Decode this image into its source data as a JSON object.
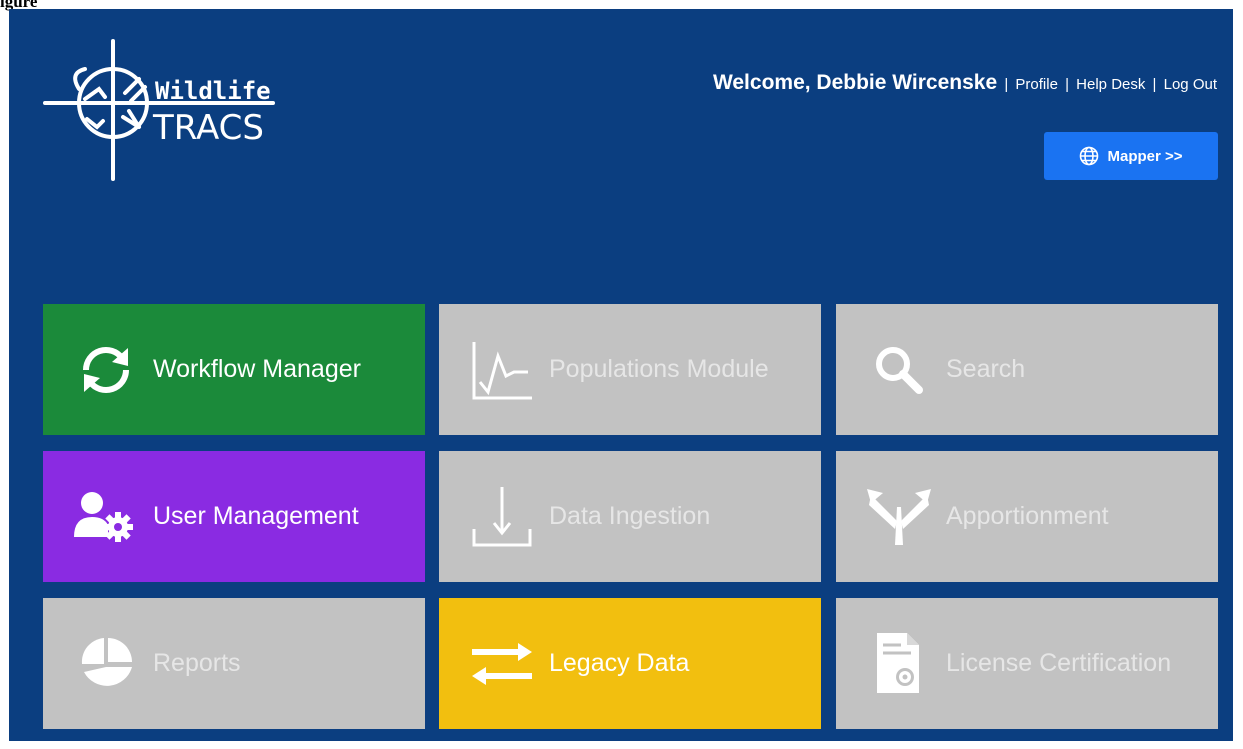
{
  "caption": "igure",
  "header": {
    "logo_line1": "Wildlife",
    "logo_line2": "TRACS",
    "welcome": "Welcome, Debbie Wircenske",
    "separator": "|",
    "links": {
      "profile": "Profile",
      "help": "Help Desk",
      "logout": "Log Out"
    },
    "mapper_label": "Mapper >>",
    "mapper_icon": "globe-icon"
  },
  "tiles": [
    {
      "label": "Workflow Manager",
      "icon": "refresh-icon",
      "color": "#1b8a3a",
      "enabled": true
    },
    {
      "label": "Populations Module",
      "icon": "line-chart-icon",
      "color": "#c2c2c2",
      "enabled": false
    },
    {
      "label": "Search",
      "icon": "search-icon",
      "color": "#c2c2c2",
      "enabled": false
    },
    {
      "label": "User Management",
      "icon": "user-gear-icon",
      "color": "#8a2be2",
      "enabled": true
    },
    {
      "label": "Data Ingestion",
      "icon": "download-tray-icon",
      "color": "#c2c2c2",
      "enabled": false
    },
    {
      "label": "Apportionment",
      "icon": "split-arrows-icon",
      "color": "#c2c2c2",
      "enabled": false
    },
    {
      "label": "Reports",
      "icon": "pie-chart-icon",
      "color": "#c2c2c2",
      "enabled": false
    },
    {
      "label": "Legacy Data",
      "icon": "transfer-arrows-icon",
      "color": "#f2bf0f",
      "enabled": true
    },
    {
      "label": "License Certification",
      "icon": "certificate-gear-icon",
      "color": "#c2c2c2",
      "enabled": false
    }
  ]
}
